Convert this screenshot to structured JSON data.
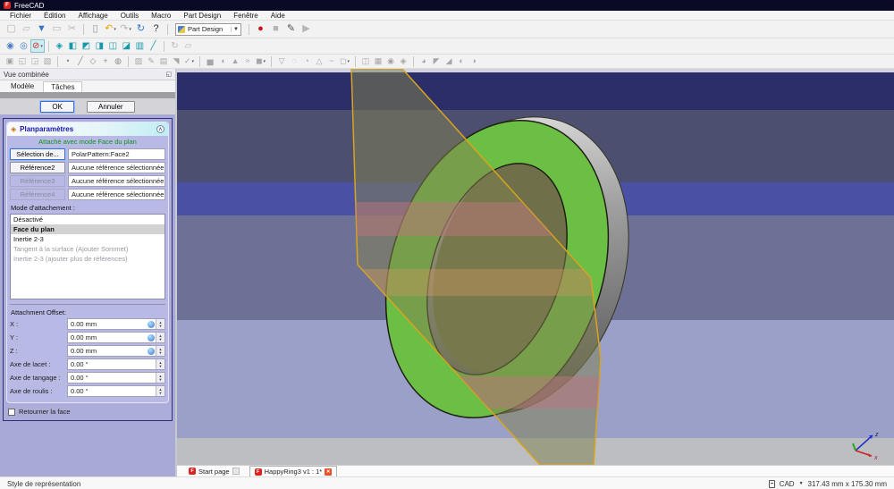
{
  "window": {
    "title": "FreeCAD",
    "titlebar_color": "#0a0a24"
  },
  "menu_bar": {
    "items": [
      "Fichier",
      "Édition",
      "Affichage",
      "Outils",
      "Macro",
      "Part Design",
      "Fenêtre",
      "Aide"
    ]
  },
  "toolbars": {
    "file": [
      [
        {
          "name": "new-file",
          "glyph": "▢",
          "color": "#b6b6b6",
          "enabled": false
        },
        {
          "name": "open-file",
          "glyph": "▱",
          "color": "#b6b6b6",
          "enabled": false
        },
        {
          "name": "save-file",
          "glyph": "▼",
          "color": "#3b76c4",
          "enabled": true
        },
        {
          "name": "print",
          "glyph": "▭",
          "color": "#b6b6b6",
          "enabled": false
        },
        {
          "name": "cut",
          "glyph": "✂",
          "color": "#b6b6b6",
          "enabled": false
        }
      ],
      [
        {
          "name": "paste",
          "glyph": "▯",
          "color": "#8e8e8e",
          "enabled": true
        },
        {
          "name": "undo",
          "glyph": "↶",
          "color": "#e2a500",
          "enabled": true,
          "dropdown": true
        },
        {
          "name": "redo",
          "glyph": "↷",
          "color": "#b6b6b6",
          "enabled": false,
          "dropdown": true
        },
        {
          "name": "refresh",
          "glyph": "↻",
          "color": "#2b7bd4",
          "enabled": true
        },
        {
          "name": "whats-this",
          "glyph": "?",
          "color": "#303030",
          "enabled": true
        }
      ]
    ],
    "workbench_selector": {
      "value": "Part Design"
    },
    "macro": [
      [
        {
          "name": "macro-record",
          "glyph": "●",
          "color": "#c81414",
          "enabled": true
        },
        {
          "name": "macro-stop",
          "glyph": "■",
          "color": "#b6b6b6",
          "enabled": false
        },
        {
          "name": "macro-edit",
          "glyph": "✎",
          "color": "#505050",
          "enabled": true
        },
        {
          "name": "macro-play",
          "glyph": "▶",
          "color": "#b6b6b6",
          "enabled": false
        }
      ]
    ],
    "view": [
      [
        {
          "name": "fit-all",
          "glyph": "◉",
          "color": "#4a7dbf",
          "enabled": true
        },
        {
          "name": "fit-selection",
          "glyph": "◎",
          "color": "#3a7bd0",
          "enabled": true
        },
        {
          "name": "draw-style",
          "glyph": "⊘",
          "color": "#d42020",
          "enabled": true,
          "dropdown": true,
          "pressed": true
        }
      ],
      [
        {
          "name": "view-isometric",
          "glyph": "◈",
          "color": "#169aab",
          "enabled": true
        },
        {
          "name": "view-front",
          "glyph": "◧",
          "color": "#169aab",
          "enabled": true
        },
        {
          "name": "view-top",
          "glyph": "◩",
          "color": "#169aab",
          "enabled": true
        },
        {
          "name": "view-right",
          "glyph": "◨",
          "color": "#169aab",
          "enabled": true
        },
        {
          "name": "view-rear",
          "glyph": "◫",
          "color": "#169aab",
          "enabled": true
        },
        {
          "name": "view-bottom",
          "glyph": "◪",
          "color": "#169aab",
          "enabled": true
        },
        {
          "name": "view-left",
          "glyph": "▥",
          "color": "#169aab",
          "enabled": true
        },
        {
          "name": "measure-distance",
          "glyph": "╱",
          "color": "#169aab",
          "enabled": true
        }
      ],
      [
        {
          "name": "measure-refresh",
          "glyph": "↻",
          "color": "#b6b6b6",
          "enabled": false
        },
        {
          "name": "measure-toggle",
          "glyph": "▱",
          "color": "#b6b6b6",
          "enabled": false
        }
      ]
    ],
    "partdesign": [
      [
        {
          "name": "create-body",
          "glyph": "▣",
          "color": "#a6a6a6",
          "enabled": false
        },
        {
          "name": "create-shapebinder",
          "glyph": "◱",
          "color": "#a6a6a6",
          "enabled": false
        },
        {
          "name": "create-clone",
          "glyph": "◲",
          "color": "#a6a6a6",
          "enabled": false
        },
        {
          "name": "migrate",
          "glyph": "▧",
          "color": "#a6a6a6",
          "enabled": false
        }
      ],
      [
        {
          "name": "datum-point",
          "glyph": "•",
          "color": "#8e8e8e",
          "enabled": false
        },
        {
          "name": "datum-line",
          "glyph": "╱",
          "color": "#8e8e8e",
          "enabled": false
        },
        {
          "name": "datum-plane",
          "glyph": "◇",
          "color": "#8e8e8e",
          "enabled": false
        },
        {
          "name": "local-coordinate-system",
          "glyph": "+",
          "color": "#8e8e8e",
          "enabled": false
        },
        {
          "name": "create-datum",
          "glyph": "◍",
          "color": "#8e8e8e",
          "enabled": false
        }
      ],
      [
        {
          "name": "new-sketch",
          "glyph": "▨",
          "color": "#a6a6a6",
          "enabled": false
        },
        {
          "name": "edit-sketch",
          "glyph": "✎",
          "color": "#a6a6a6",
          "enabled": false
        },
        {
          "name": "map-sketch",
          "glyph": "▤",
          "color": "#a6a6a6",
          "enabled": false
        },
        {
          "name": "reorient-sketch",
          "glyph": "◥",
          "color": "#a6a6a6",
          "enabled": false
        },
        {
          "name": "validate-sketch",
          "glyph": "✓",
          "color": "#a6a6a6",
          "enabled": false,
          "dropdown": true
        }
      ],
      [
        {
          "name": "pad",
          "glyph": "▅",
          "color": "#a6a6a6",
          "enabled": false
        },
        {
          "name": "revolution",
          "glyph": "◖",
          "color": "#a6a6a6",
          "enabled": false
        },
        {
          "name": "additive-loft",
          "glyph": "▲",
          "color": "#a6a6a6",
          "enabled": false
        },
        {
          "name": "additive-pipe",
          "glyph": "≈",
          "color": "#a6a6a6",
          "enabled": false
        },
        {
          "name": "additive-primitive",
          "glyph": "◼",
          "color": "#a6a6a6",
          "enabled": false,
          "dropdown": true
        }
      ],
      [
        {
          "name": "pocket",
          "glyph": "▽",
          "color": "#a6a6a6",
          "enabled": false
        },
        {
          "name": "hole",
          "glyph": "◌",
          "color": "#a6a6a6",
          "enabled": false
        },
        {
          "name": "groove",
          "glyph": "◔",
          "color": "#a6a6a6",
          "enabled": false
        },
        {
          "name": "subtractive-loft",
          "glyph": "△",
          "color": "#a6a6a6",
          "enabled": false
        },
        {
          "name": "subtractive-pipe",
          "glyph": "~",
          "color": "#a6a6a6",
          "enabled": false
        },
        {
          "name": "subtractive-primitive",
          "glyph": "◻",
          "color": "#a6a6a6",
          "enabled": false,
          "dropdown": true
        }
      ],
      [
        {
          "name": "mirrored",
          "glyph": "◫",
          "color": "#a6a6a6",
          "enabled": false
        },
        {
          "name": "linear-pattern",
          "glyph": "▦",
          "color": "#a6a6a6",
          "enabled": false
        },
        {
          "name": "polar-pattern",
          "glyph": "◉",
          "color": "#a6a6a6",
          "enabled": false
        },
        {
          "name": "multitransform",
          "glyph": "◈",
          "color": "#a6a6a6",
          "enabled": false
        }
      ],
      [
        {
          "name": "fillet",
          "glyph": "◕",
          "color": "#a6a6a6",
          "enabled": false
        },
        {
          "name": "chamfer",
          "glyph": "◤",
          "color": "#a6a6a6",
          "enabled": false
        },
        {
          "name": "draft",
          "glyph": "◢",
          "color": "#a6a6a6",
          "enabled": false
        },
        {
          "name": "thickness",
          "glyph": "◐",
          "color": "#a6a6a6",
          "enabled": false
        },
        {
          "name": "boolean-operation",
          "glyph": "◑",
          "color": "#a6a6a6",
          "enabled": false
        }
      ]
    ]
  },
  "combined_view": {
    "title": "Vue combinée",
    "tabs": [
      {
        "label": "Modèle",
        "active": false
      },
      {
        "label": "Tâches",
        "active": true
      }
    ],
    "ok_label": "OK",
    "cancel_label": "Annuler",
    "task": {
      "title": "Planparamètres",
      "status_text": "Attaché avec mode Face du plan",
      "reference_rows": [
        {
          "button": "Sélection de...",
          "value": "PolarPattern:Face2",
          "enabled": true,
          "focused": true
        },
        {
          "button": "Référence2",
          "value": "Aucune référence sélectionnée",
          "enabled": true,
          "focused": false
        },
        {
          "button": "Référence3",
          "value": "Aucune référence sélectionnée",
          "enabled": false,
          "focused": false
        },
        {
          "button": "Référence4",
          "value": "Aucune référence sélectionnée",
          "enabled": false,
          "focused": false
        }
      ],
      "attachment_mode_label": "Mode d'attachement :",
      "attachment_modes": [
        {
          "label": "Désactivé",
          "state": "normal"
        },
        {
          "label": "Face du plan",
          "state": "selected"
        },
        {
          "label": "Inertie 2-3",
          "state": "normal"
        },
        {
          "label": "Tangent à la surface (Ajouter Sommet)",
          "state": "disabled"
        },
        {
          "label": "Inertie 2-3 (ajouter plus de références)",
          "state": "disabled"
        }
      ],
      "offset_label": "Attachment Offset:",
      "offset_rows": [
        {
          "label": "X :",
          "value": "0.00 mm",
          "expression_icon": true
        },
        {
          "label": "Y :",
          "value": "0.00 mm",
          "expression_icon": true
        },
        {
          "label": "Z :",
          "value": "0.00 mm",
          "expression_icon": true
        },
        {
          "label": "Axe de lacet :",
          "value": "0.00 °",
          "expression_icon": false
        },
        {
          "label": "Axe de tangage :",
          "value": "0.00 °",
          "expression_icon": false
        },
        {
          "label": "Axe de roulis :",
          "value": "0.00 °",
          "expression_icon": false
        }
      ],
      "flip_checkbox_label": "Retourner la face",
      "flip_checkbox_checked": false
    }
  },
  "viewport": {
    "stripes": [
      {
        "color": "#d2d2e0",
        "height": 4
      },
      {
        "color": "#2b2e68",
        "height": 42
      },
      {
        "color": "#4c4f6f",
        "height": 81
      },
      {
        "color": "#4a51a5",
        "height": 37
      },
      {
        "color": "#6e7196",
        "height": 117
      },
      {
        "color": "#9aa0c8",
        "height": 132
      },
      {
        "color": "#bdbec1",
        "height": 30
      }
    ],
    "model": {
      "ring_color": "#6cbf45",
      "ring_outline": "#1e1e12",
      "inner_wall_color": "#6f6f49",
      "plane_fill": "rgba(128,128,80,0.52)",
      "plane_outline": "#d9a41e",
      "band_pink": "rgba(188,118,124,0.5)",
      "band_tan": "rgba(206,152,96,0.42)"
    },
    "axis": {
      "z_label": "z",
      "x_label": "x",
      "z_color": "#2233cc",
      "x_color": "#cc2222",
      "y_color": "#22aa22"
    }
  },
  "mdi_tabs": [
    {
      "label": "Start page",
      "active": false
    },
    {
      "label": "HappyRing3 v1 : 1*",
      "active": true
    }
  ],
  "status_bar": {
    "left_text": "Style de représentation",
    "nav_style_label": "CAD",
    "dimensions": "317.43 mm x 175.30 mm"
  }
}
